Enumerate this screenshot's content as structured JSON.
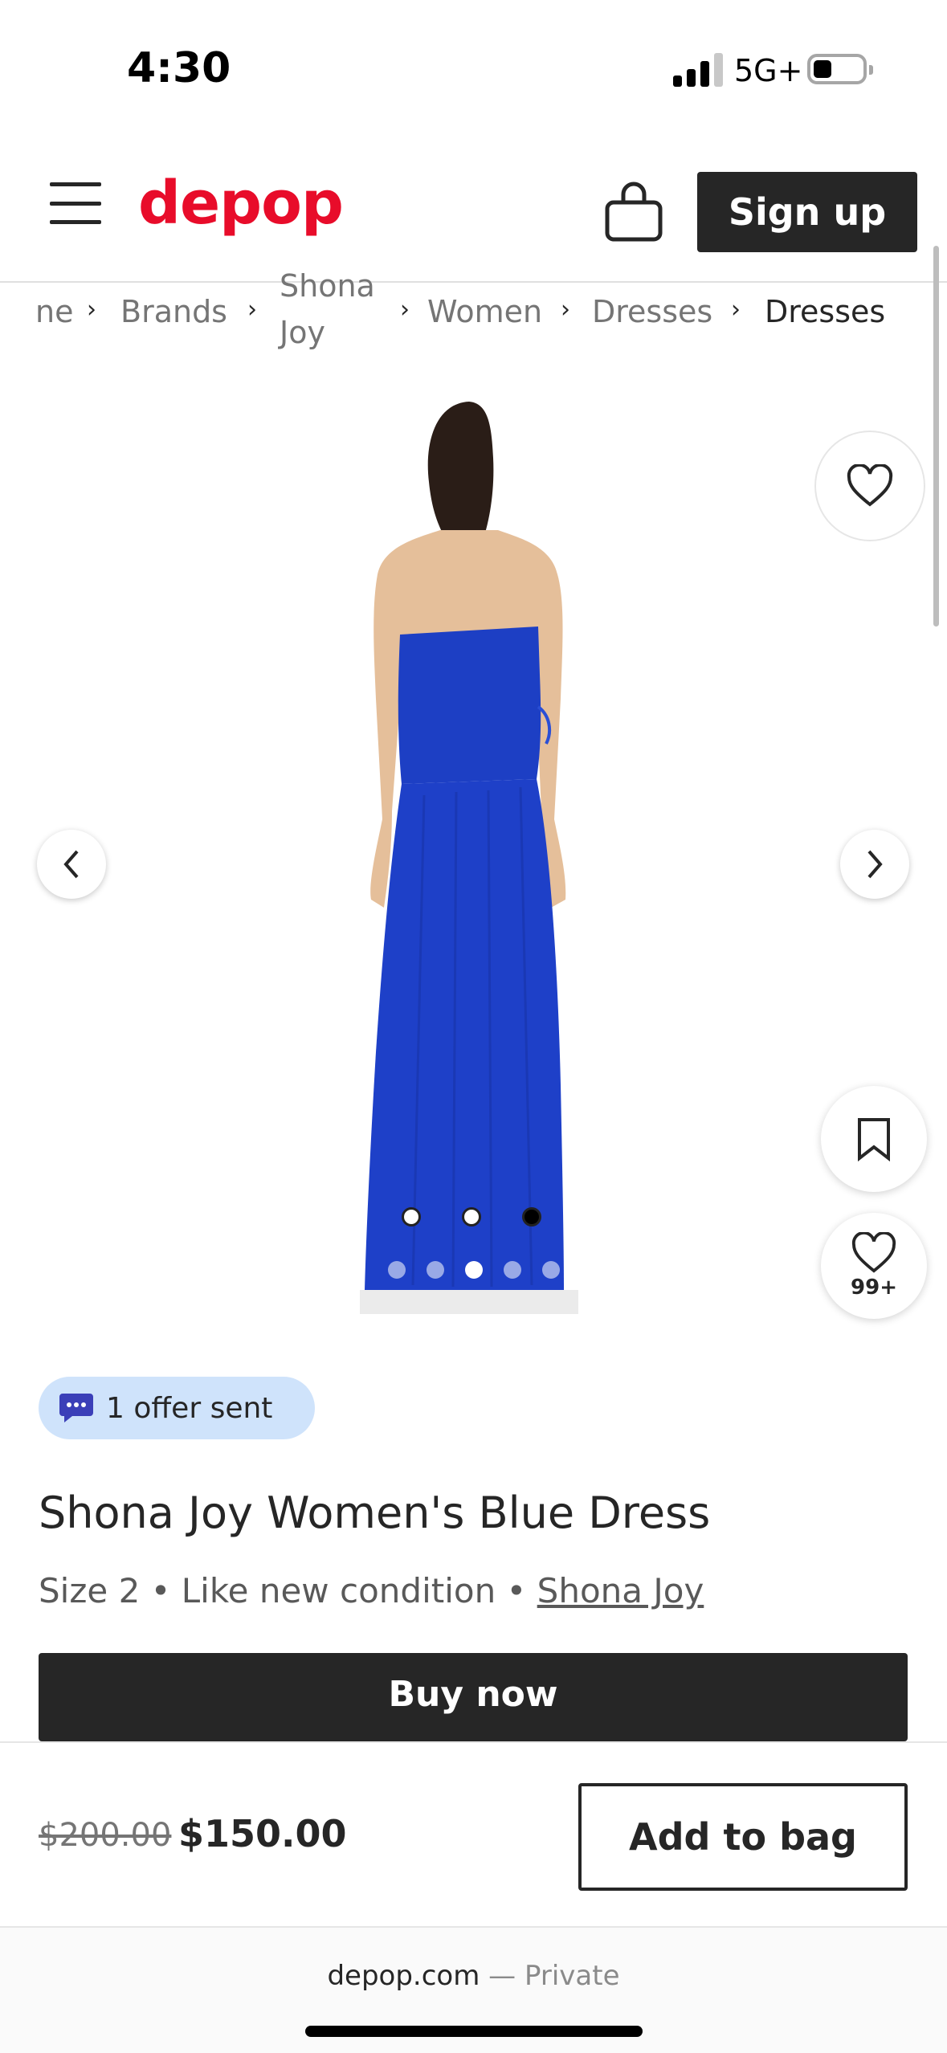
{
  "status_bar": {
    "time": "4:30",
    "network": "5G+"
  },
  "header": {
    "logo": "depop",
    "signup_label": "Sign up"
  },
  "breadcrumb": {
    "items": [
      "ne",
      "Brands",
      "Shona",
      "Joy",
      "Women",
      "Dresses",
      "Dresses"
    ]
  },
  "image_carousel": {
    "active_index": 2,
    "dot_count": 5,
    "likes_count": "99+"
  },
  "offer": {
    "label": "1 offer sent"
  },
  "product": {
    "title": "Shona Joy Women's Blue Dress",
    "meta_prefix": "Size 2 • Like new condition • ",
    "brand_link": "Shona Joy",
    "buy_label": "Buy now"
  },
  "pricing": {
    "original_price": "$200.00",
    "sale_price": "$150.00",
    "add_to_bag_label": "Add to bag"
  },
  "browser": {
    "domain": "depop.com",
    "privacy": " — Private"
  },
  "colors": {
    "brand": "#e80c2a",
    "dark": "#262626",
    "offer_bg": "#cfe3fb",
    "dress": "#1d3fc4"
  }
}
